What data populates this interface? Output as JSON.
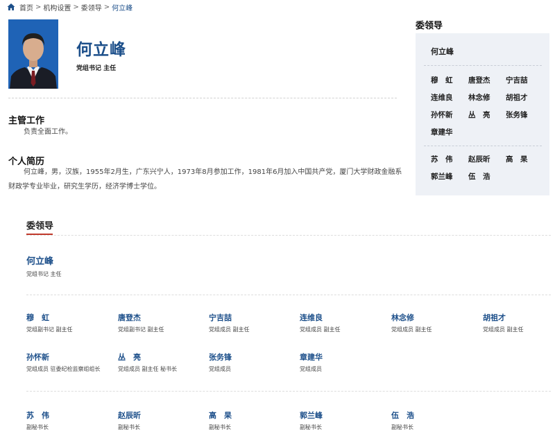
{
  "breadcrumb": {
    "items": [
      "首页",
      "机构设置",
      "委领导",
      "何立峰"
    ],
    "separator": ">"
  },
  "profile": {
    "name": "何立峰",
    "title": "党组书记 主任",
    "section1_heading": "主管工作",
    "section1_text": "负责全面工作。",
    "section2_heading": "个人简历",
    "section2_text": "何立峰，男，汉族，1955年2月生，广东兴宁人，1973年8月参加工作，1981年6月加入中国共产党，厦门大学财政金融系财政学专业毕业，研究生学历，经济学博士学位。"
  },
  "sidebar": {
    "title": "委领导",
    "lead": "何立峰",
    "group1": [
      "穆　虹",
      "唐登杰",
      "宁吉喆",
      "连维良",
      "林念修",
      "胡祖才",
      "孙怀新",
      "丛　亮",
      "张务锋",
      "章建华"
    ],
    "group2": [
      "苏　伟",
      "赵辰昕",
      "高　杲",
      "郭兰峰",
      "伍　浩"
    ]
  },
  "leaders": {
    "title": "委领导",
    "lead": {
      "name": "何立峰",
      "title": "党组书记 主任"
    },
    "row1": [
      {
        "name": "穆　虹",
        "title": "党组副书记 副主任"
      },
      {
        "name": "唐登杰",
        "title": "党组副书记 副主任"
      },
      {
        "name": "宁吉喆",
        "title": "党组成员 副主任"
      },
      {
        "name": "连维良",
        "title": "党组成员 副主任"
      },
      {
        "name": "林念修",
        "title": "党组成员 副主任"
      },
      {
        "name": "胡祖才",
        "title": "党组成员 副主任"
      }
    ],
    "row2": [
      {
        "name": "孙怀新",
        "title": "党组成员 驻委纪检监察组组长"
      },
      {
        "name": "丛　亮",
        "title": "党组成员 副主任 秘书长"
      },
      {
        "name": "张务锋",
        "title": "党组成员"
      },
      {
        "name": "章建华",
        "title": "党组成员"
      }
    ],
    "row3": [
      {
        "name": "苏　伟",
        "title": "副秘书长"
      },
      {
        "name": "赵辰昕",
        "title": "副秘书长"
      },
      {
        "name": "高　杲",
        "title": "副秘书长"
      },
      {
        "name": "郭兰峰",
        "title": "副秘书长"
      },
      {
        "name": "伍　浩",
        "title": "副秘书长"
      }
    ]
  },
  "colors": {
    "name_blue": "#1c4f8a",
    "accent_red": "#c0392b",
    "sidebar_bg": "#eef1f6",
    "photo_bg": "#1f63b6"
  }
}
